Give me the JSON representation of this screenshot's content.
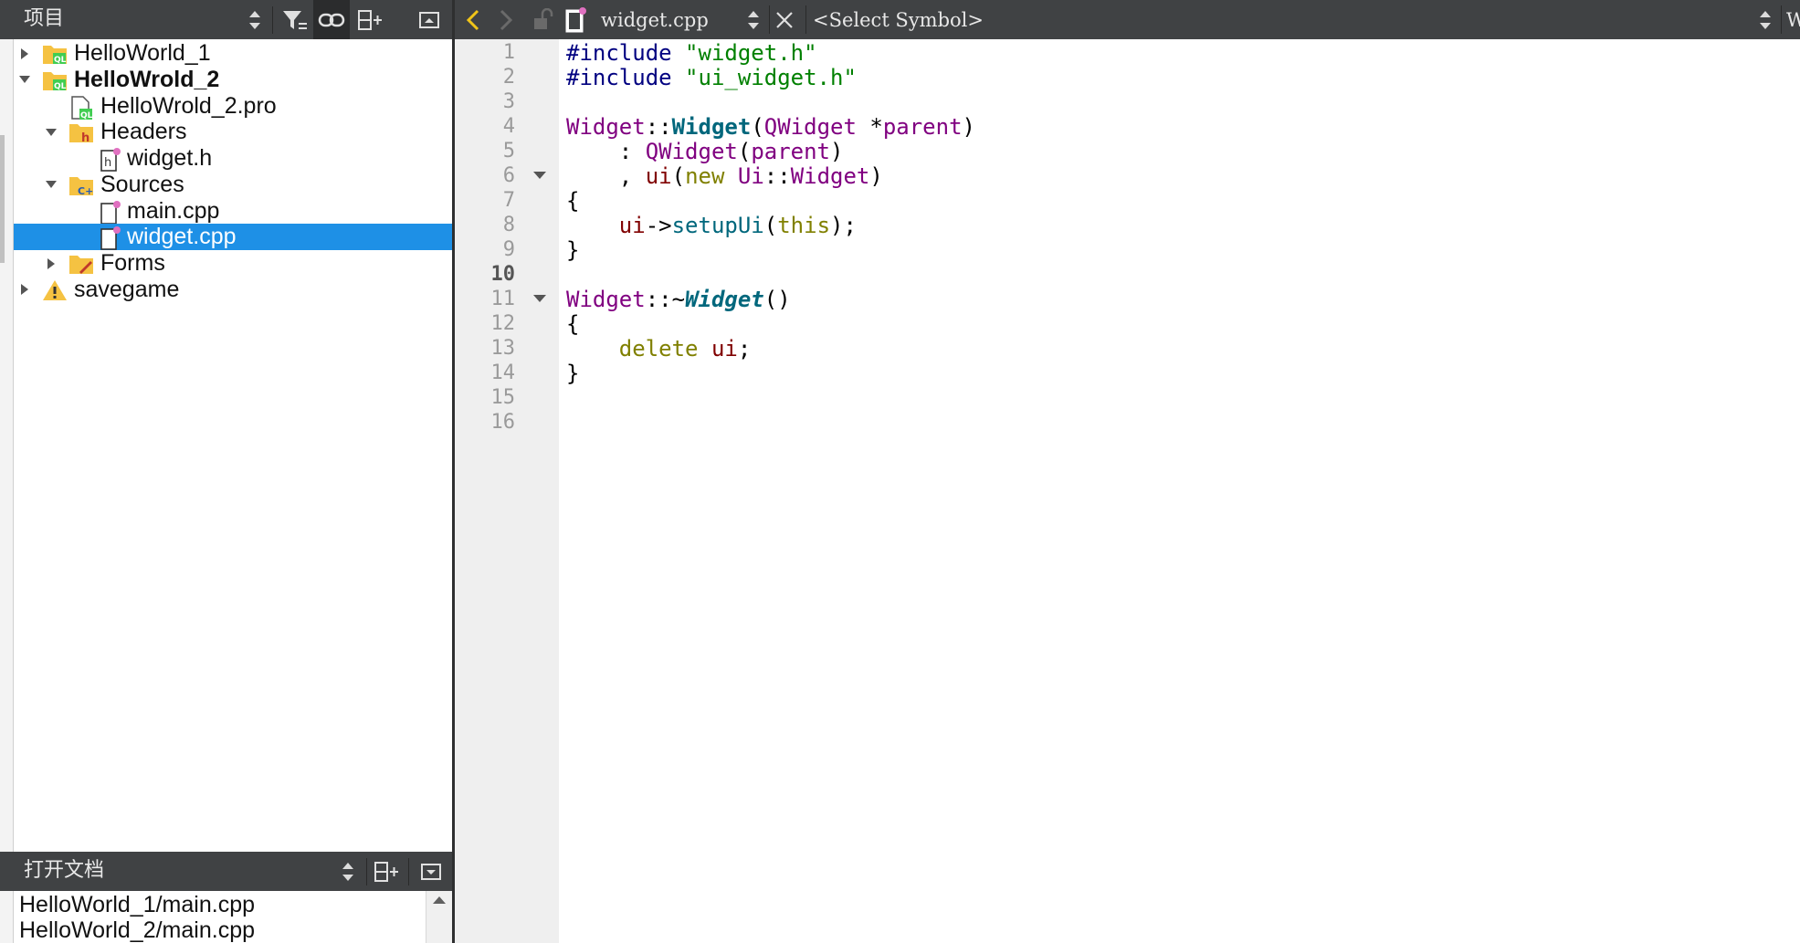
{
  "project_pane": {
    "title": "项目",
    "tree": [
      {
        "label": "HelloWorld_1",
        "bold": false,
        "expanded": false,
        "level": 0,
        "icon": "qt-project-folder-icon",
        "has_arrow": true
      },
      {
        "label": "HelloWrold_2",
        "bold": true,
        "expanded": true,
        "level": 0,
        "icon": "qt-project-folder-icon",
        "has_arrow": true
      },
      {
        "label": "HelloWrold_2.pro",
        "bold": false,
        "level": 1,
        "icon": "qt-pro-file-icon",
        "has_arrow": false
      },
      {
        "label": "Headers",
        "bold": false,
        "expanded": true,
        "level": 1,
        "icon": "headers-folder-icon",
        "has_arrow": true
      },
      {
        "label": "widget.h",
        "bold": false,
        "level": 2,
        "icon": "header-file-icon",
        "has_arrow": false
      },
      {
        "label": "Sources",
        "bold": false,
        "expanded": true,
        "level": 1,
        "icon": "sources-folder-icon",
        "has_arrow": true
      },
      {
        "label": "main.cpp",
        "bold": false,
        "level": 2,
        "icon": "cpp-file-icon",
        "has_arrow": false
      },
      {
        "label": "widget.cpp",
        "bold": false,
        "level": 2,
        "icon": "cpp-file-icon",
        "has_arrow": false,
        "selected": true
      },
      {
        "label": "Forms",
        "bold": false,
        "expanded": false,
        "level": 1,
        "icon": "forms-folder-icon",
        "has_arrow": true
      },
      {
        "label": "savegame",
        "bold": false,
        "expanded": false,
        "level": 0,
        "icon": "warning-icon",
        "has_arrow": true
      }
    ]
  },
  "open_documents": {
    "title": "打开文档",
    "items": [
      "HelloWorld_1/main.cpp",
      "HelloWorld_2/main.cpp"
    ]
  },
  "editor_toolbar": {
    "file_name": "widget.cpp",
    "symbol": "<Select Symbol>",
    "encoding": "Window"
  },
  "editor": {
    "current_line": 10,
    "line_numbers": [
      "1",
      "2",
      "3",
      "4",
      "5",
      "6",
      "7",
      "8",
      "9",
      "10",
      "11",
      "12",
      "13",
      "14",
      "15",
      "16"
    ],
    "fold_markers": [
      6,
      11
    ],
    "lines": [
      [
        {
          "t": "#include ",
          "c": "pp"
        },
        {
          "t": "\"widget.h\"",
          "c": "str"
        }
      ],
      [
        {
          "t": "#include ",
          "c": "pp"
        },
        {
          "t": "\"ui_widget.h\"",
          "c": "str"
        }
      ],
      [],
      [
        {
          "t": "Widget",
          "c": "type"
        },
        {
          "t": "::",
          "c": "plain"
        },
        {
          "t": "Widget",
          "c": "fn"
        },
        {
          "t": "(",
          "c": "plain"
        },
        {
          "t": "QWidget",
          "c": "type"
        },
        {
          "t": " *",
          "c": "plain"
        },
        {
          "t": "parent",
          "c": "type"
        },
        {
          "t": ")",
          "c": "plain"
        }
      ],
      [
        {
          "t": "    : ",
          "c": "plain"
        },
        {
          "t": "QWidget",
          "c": "type"
        },
        {
          "t": "(",
          "c": "plain"
        },
        {
          "t": "parent",
          "c": "type"
        },
        {
          "t": ")",
          "c": "plain"
        }
      ],
      [
        {
          "t": "    , ",
          "c": "plain"
        },
        {
          "t": "ui",
          "c": "mem"
        },
        {
          "t": "(",
          "c": "plain"
        },
        {
          "t": "new",
          "c": "kw"
        },
        {
          "t": " ",
          "c": "plain"
        },
        {
          "t": "Ui",
          "c": "type"
        },
        {
          "t": "::",
          "c": "plain"
        },
        {
          "t": "Widget",
          "c": "type"
        },
        {
          "t": ")",
          "c": "plain"
        }
      ],
      [
        {
          "t": "{",
          "c": "plain"
        }
      ],
      [
        {
          "t": "    ",
          "c": "plain"
        },
        {
          "t": "ui",
          "c": "mem"
        },
        {
          "t": "->",
          "c": "plain"
        },
        {
          "t": "setupUi",
          "c": "call"
        },
        {
          "t": "(",
          "c": "plain"
        },
        {
          "t": "this",
          "c": "kw"
        },
        {
          "t": ");",
          "c": "plain"
        }
      ],
      [
        {
          "t": "}",
          "c": "plain"
        }
      ],
      [],
      [
        {
          "t": "Widget",
          "c": "type"
        },
        {
          "t": "::~",
          "c": "plain"
        },
        {
          "t": "Widget",
          "c": "fni"
        },
        {
          "t": "()",
          "c": "plain"
        }
      ],
      [
        {
          "t": "{",
          "c": "plain"
        }
      ],
      [
        {
          "t": "    ",
          "c": "plain"
        },
        {
          "t": "delete",
          "c": "kw"
        },
        {
          "t": " ",
          "c": "plain"
        },
        {
          "t": "ui",
          "c": "mem"
        },
        {
          "t": ";",
          "c": "plain"
        }
      ],
      [
        {
          "t": "}",
          "c": "plain"
        }
      ],
      [],
      []
    ]
  }
}
